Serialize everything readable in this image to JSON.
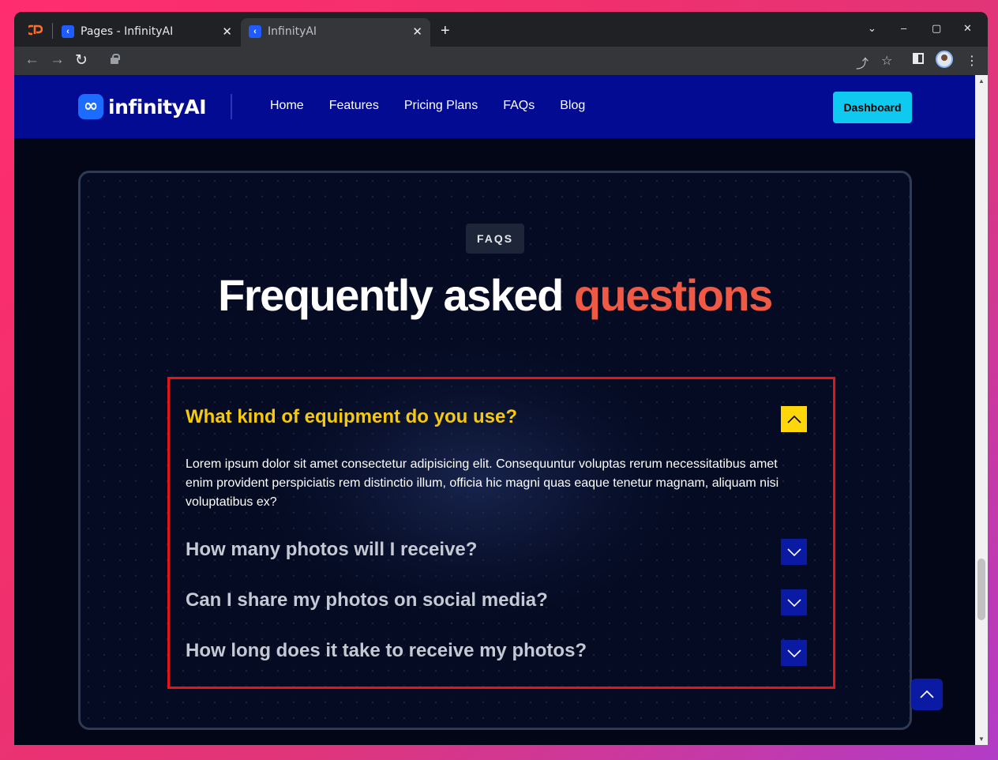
{
  "browser": {
    "tabs": [
      {
        "title": "Pages - InfinityAI",
        "close": "✕"
      },
      {
        "title": "InfinityAI",
        "close": "✕"
      }
    ],
    "new_tab": "+",
    "window_controls": {
      "menu": "⌄",
      "minimize": "–",
      "maximize": "▢",
      "close": "✕"
    },
    "toolbar": {
      "back": "←",
      "forward": "→",
      "reload": "↻",
      "share": "⤴",
      "star": "☆",
      "menu": "⋮"
    }
  },
  "site": {
    "logo_mark": "∞",
    "logo_text": "infinityAI",
    "nav": [
      "Home",
      "Features",
      "Pricing Plans",
      "FAQs",
      "Blog"
    ],
    "cta": "Dashboard"
  },
  "faq": {
    "badge": "FAQS",
    "heading_main": "Frequently asked ",
    "heading_accent": "questions",
    "items": [
      {
        "question": "What kind of equipment do you use?",
        "answer": "Lorem ipsum dolor sit amet consectetur adipisicing elit. Consequuntur voluptas rerum necessitatibus amet enim provident perspiciatis rem distinctio illum, officia hic magni quas eaque tenetur magnam, aliquam nisi voluptatibus ex?",
        "expanded": true
      },
      {
        "question": "How many photos will I receive?",
        "expanded": false
      },
      {
        "question": "Can I share my photos on social media?",
        "expanded": false
      },
      {
        "question": "How long does it take to receive my photos?",
        "expanded": false
      }
    ]
  },
  "colors": {
    "nav_bg": "#020b91",
    "cta_bg": "#0ecaf0",
    "accent_text": "#f05a45",
    "open_question": "#f6c90e",
    "open_toggle": "#ffd60a",
    "closed_toggle": "#0b1aa3",
    "highlight_border": "#e4141b"
  }
}
